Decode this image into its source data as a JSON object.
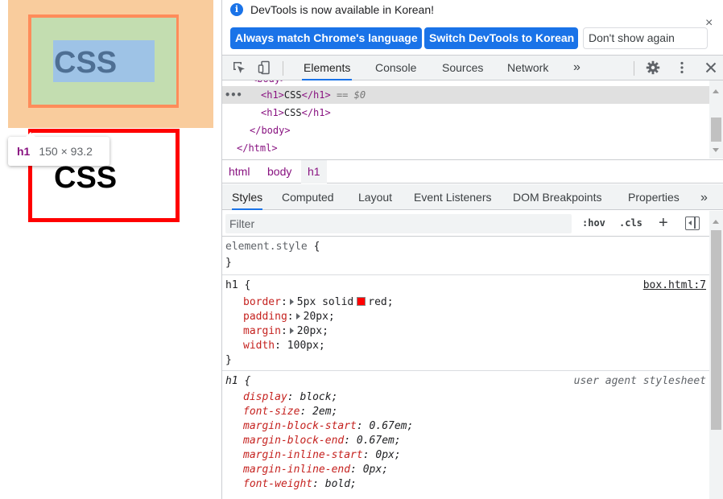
{
  "viewport": {
    "highlight_text": "CSS",
    "second_text": "CSS",
    "tooltip": {
      "tag": "h1",
      "size": "150 × 93.2"
    }
  },
  "infobar": {
    "icon": "info-icon",
    "message": "DevTools is now available in Korean!",
    "btn_match": "Always match Chrome's language",
    "btn_switch": "Switch DevTools to Korean",
    "btn_dont_show": "Don't show again",
    "close": "×"
  },
  "main_tabs": [
    "Elements",
    "Console",
    "Sources",
    "Network"
  ],
  "more_tabs": "»",
  "tree": {
    "cut_line": "<body>",
    "ellipsis": "•••",
    "rows": [
      {
        "open": "<h1>",
        "text": "CSS",
        "close": "</h1>",
        "eq": " == $0"
      },
      {
        "open": "<h1>",
        "text": "CSS",
        "close": "</h1>"
      },
      {
        "tag": "</body>"
      },
      {
        "tag": "</html>"
      }
    ]
  },
  "breadcrumbs": [
    "html",
    "body",
    "h1"
  ],
  "styles_tabs": [
    "Styles",
    "Computed",
    "Layout",
    "Event Listeners",
    "DOM Breakpoints",
    "Properties"
  ],
  "styles_more": "»",
  "filter": {
    "placeholder": "Filter",
    "hov": ":hov",
    "cls": ".cls",
    "plus": "+"
  },
  "rules": {
    "element_style": {
      "selector": "element.style",
      "open": "{",
      "close": "}"
    },
    "h1_rule": {
      "selector": "h1",
      "open": "{",
      "close": "}",
      "source": "box.html:7",
      "decls": [
        {
          "prop": "border",
          "value_a": "5px solid",
          "value_b": "red;",
          "swatch": "#ff0000"
        },
        {
          "prop": "padding",
          "value": "20px;"
        },
        {
          "prop": "margin",
          "value": "20px;"
        },
        {
          "prop": "width",
          "value": "100px;"
        }
      ]
    },
    "ua_rule": {
      "selector": "h1",
      "open": "{",
      "source": "user agent stylesheet",
      "decls": [
        {
          "prop": "display",
          "value": "block;"
        },
        {
          "prop": "font-size",
          "value": "2em;"
        },
        {
          "prop": "margin-block-start",
          "value": "0.67em;"
        },
        {
          "prop": "margin-block-end",
          "value": "0.67em;"
        },
        {
          "prop": "margin-inline-start",
          "value": "0px;"
        },
        {
          "prop": "margin-inline-end",
          "value": "0px;"
        },
        {
          "prop": "font-weight",
          "value": "bold;"
        }
      ]
    }
  },
  "colors": {
    "accent": "#1a73e8",
    "tag": "#881280",
    "property": "#c5221f",
    "margin_highlight": "#f9cc9d",
    "border_highlight": "#ff8c5a",
    "padding_highlight": "#c3ddb0",
    "content_highlight": "#9ec3e6"
  }
}
